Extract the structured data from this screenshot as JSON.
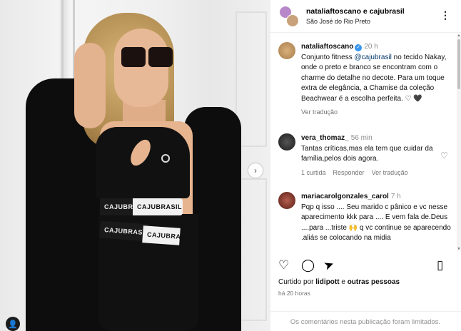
{
  "post": {
    "accounts_label": "nataliaftoscano e cajubrasil",
    "location": "São José do Rio Preto",
    "more_icon": "more-horizontal-icon"
  },
  "photo": {
    "band_brand": "CAJUBRASIL",
    "next_icon": "chevron-right-icon",
    "tag_icon": "person-tag-icon"
  },
  "caption": {
    "username": "nataliaftoscano",
    "time": "20 h",
    "text_before": "Conjunto fitness ",
    "mention": "@cajubrasil",
    "text_after": " no tecido Nakay, onde o preto e branco se encontram com o charme do detalhe no decote. Para um toque extra de elegância, a Chamise da coleção Beachwear é a escolha perfeita. ♡ 🖤",
    "see_translation": "Ver tradução"
  },
  "comments": [
    {
      "username": "vera_thomaz_",
      "time": "56 min",
      "text": "Tantas críticas,mas ela tem que cuidar da família,pelos dois agora.",
      "likes": "1 curtida",
      "reply": "Responder",
      "translate": "Ver tradução"
    },
    {
      "username": "mariacarolgonzales_carol",
      "time": "7 h",
      "text": "Pqp q isso .... Seu marido c pânico e vc nesse aparecimento kkk para .... E vem fala de.Deus ....para ...triste 🙌 q vc continue se aparecendo .aliás se colocando na midia"
    }
  ],
  "actions": {
    "like_icon": "heart-icon",
    "comment_icon": "comment-icon",
    "share_icon": "share-icon",
    "save_icon": "bookmark-icon"
  },
  "likes": {
    "prefix": "Curtido por ",
    "user": "lidipott",
    "middle": " e ",
    "others": "outras pessoas"
  },
  "posted_ago": "há 20 horas",
  "comments_disabled": "Os comentários nesta publicação foram limitados."
}
